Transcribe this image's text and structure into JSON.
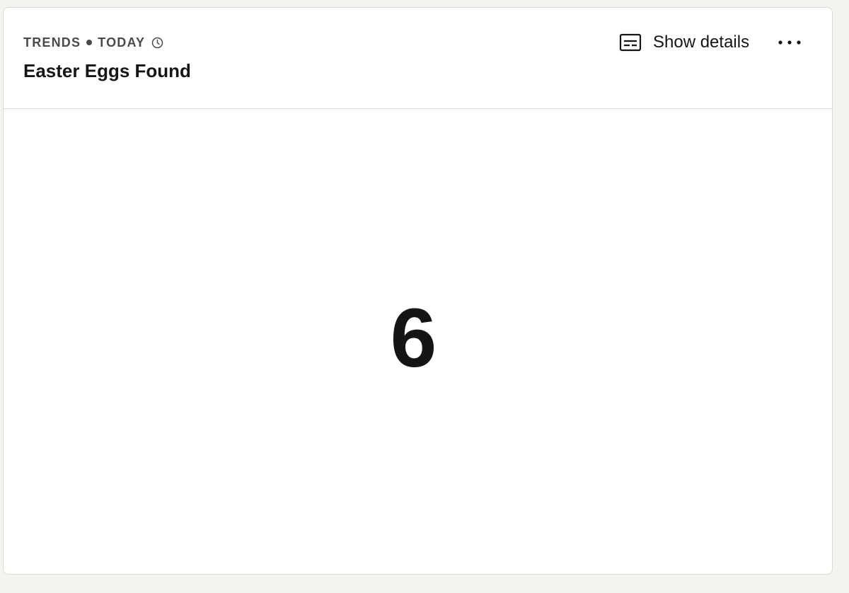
{
  "card": {
    "insight_type": "TRENDS",
    "date_range": "TODAY",
    "title": "Easter Eggs Found",
    "show_details_label": "Show details",
    "value": "6"
  },
  "icons": {
    "clock": "clock-icon",
    "details": "subtitles-icon",
    "more": "more-horizontal-icon"
  },
  "colors": {
    "page_background": "#f3f3ef",
    "card_background": "#ffffff",
    "border": "#d9d9d6",
    "text_primary": "#151515",
    "text_muted": "#4a4a4a"
  }
}
